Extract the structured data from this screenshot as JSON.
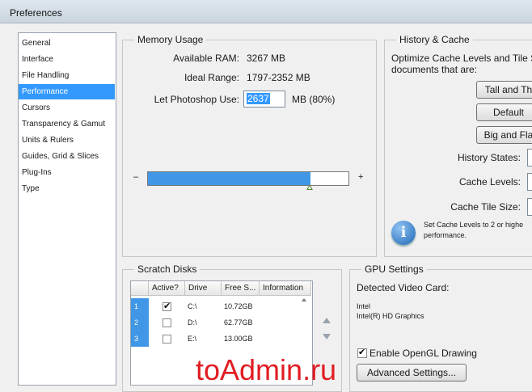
{
  "window": {
    "title": "Preferences"
  },
  "nav": {
    "items": [
      "General",
      "Interface",
      "File Handling",
      "Performance",
      "Cursors",
      "Transparency & Gamut",
      "Units & Rulers",
      "Guides, Grid & Slices",
      "Plug-Ins",
      "Type"
    ],
    "selected": "Performance"
  },
  "memory": {
    "legend": "Memory Usage",
    "available_label": "Available RAM:",
    "available_value": "3267 MB",
    "ideal_label": "Ideal Range:",
    "ideal_value": "1797-2352 MB",
    "let_label": "Let Photoshop Use:",
    "let_value": "2637",
    "let_suffix": "MB (80%)",
    "minus": "–",
    "plus": "+",
    "slider_fraction": 0.81
  },
  "history": {
    "legend": "History & Cache",
    "desc_line1": "Optimize Cache Levels and Tile S",
    "desc_line2": "documents that are:",
    "btn_tall": "Tall and Th",
    "btn_default": "Default",
    "btn_big": "Big and Fla",
    "history_states_label": "History States:",
    "cache_levels_label": "Cache Levels:",
    "cache_tile_label": "Cache Tile Size:",
    "info_line1": "Set Cache Levels to 2 or highe",
    "info_line2": "performance."
  },
  "scratch": {
    "legend": "Scratch Disks",
    "columns": [
      "Active?",
      "Drive",
      "Free S...",
      "Information"
    ],
    "rows": [
      {
        "num": "1",
        "active": true,
        "drive": "C:\\",
        "free": "10.72GB"
      },
      {
        "num": "2",
        "active": false,
        "drive": "D:\\",
        "free": "62.77GB"
      },
      {
        "num": "3",
        "active": false,
        "drive": "E:\\",
        "free": "13.00GB"
      }
    ]
  },
  "gpu": {
    "legend": "GPU Settings",
    "detected_label": "Detected Video Card:",
    "card_line1": "Intel",
    "card_line2": "Intel(R) HD Graphics",
    "opengl_label": "Enable OpenGL Drawing",
    "opengl_checked": true,
    "advanced_button": "Advanced Settings..."
  },
  "watermark": "toAdmin.ru",
  "colors": {
    "selection": "#3399ff",
    "slider_fill": "#3f97e6",
    "watermark": "#e11c23"
  }
}
